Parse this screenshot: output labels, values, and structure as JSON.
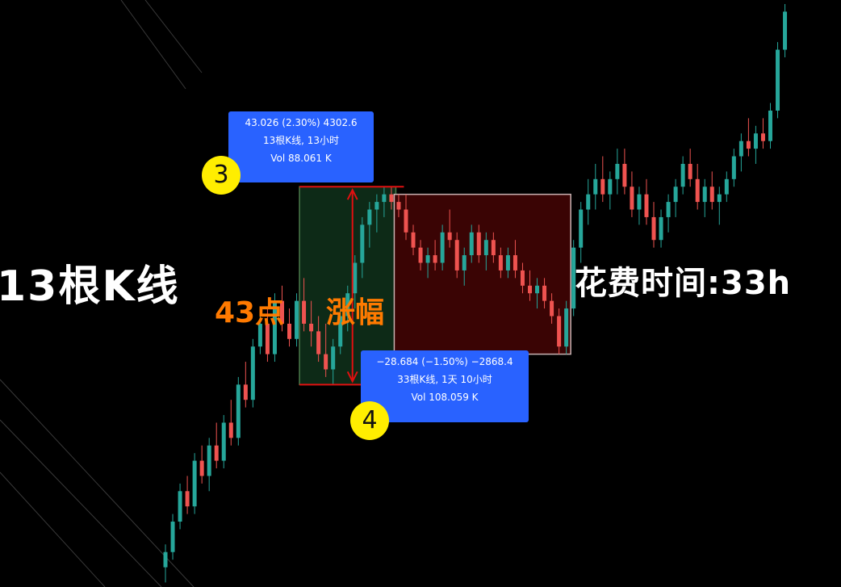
{
  "left_caption": "13根K线",
  "right_caption": "花费时间:33h",
  "points_label": "43点",
  "rise_label": "涨幅",
  "measure_up": {
    "badge": "3",
    "line1": "43.026 (2.30%) 4302.6",
    "line2": "13根K线, 13小时",
    "line3": "Vol 88.061 K"
  },
  "measure_down": {
    "badge": "4",
    "line1": "−28.684 (−1.50%) −2868.4",
    "line2": "33根K线, 1天 10小时",
    "line3": "Vol 108.059 K"
  },
  "colors": {
    "up": "#26a69a",
    "down": "#ef5350",
    "measure_up_fill": "#0d2a17",
    "measure_down_fill": "#3a0404",
    "arrow": "#e01010",
    "box": "#2962ff",
    "badge": "#ffee00",
    "accent_text": "#ff7a00"
  },
  "chart_data": {
    "type": "candlestick",
    "title": "",
    "xlabel": "",
    "ylabel": "",
    "ylim": [
      1850,
      1925
    ],
    "grid": false,
    "axes_visible": false,
    "series": [
      {
        "values": [
          [
            1851,
            1854,
            1849,
            1853
          ],
          [
            1853,
            1858,
            1852,
            1857
          ],
          [
            1857,
            1862,
            1856,
            1861
          ],
          [
            1861,
            1863,
            1858,
            1859
          ],
          [
            1859,
            1866,
            1858,
            1865
          ],
          [
            1865,
            1867,
            1862,
            1863
          ],
          [
            1863,
            1868,
            1861,
            1867
          ],
          [
            1867,
            1870,
            1864,
            1865
          ],
          [
            1865,
            1871,
            1864,
            1870
          ],
          [
            1870,
            1873,
            1867,
            1868
          ],
          [
            1868,
            1876,
            1867,
            1875
          ],
          [
            1875,
            1878,
            1872,
            1873
          ],
          [
            1873,
            1881,
            1872,
            1880
          ],
          [
            1880,
            1884,
            1879,
            1883
          ],
          [
            1883,
            1885,
            1878,
            1879
          ],
          [
            1879,
            1887,
            1878,
            1886
          ],
          [
            1886,
            1888,
            1882,
            1883
          ],
          [
            1883,
            1885,
            1880,
            1881
          ],
          [
            1881,
            1887,
            1880,
            1886
          ],
          [
            1886,
            1889,
            1882,
            1883
          ],
          [
            1883,
            1886,
            1880,
            1882
          ],
          [
            1882,
            1884,
            1878,
            1879
          ],
          [
            1879,
            1883,
            1876,
            1877
          ],
          [
            1877,
            1881,
            1875,
            1880
          ],
          [
            1880,
            1885,
            1879,
            1884
          ],
          [
            1884,
            1888,
            1882,
            1887
          ],
          [
            1887,
            1892,
            1885,
            1891
          ],
          [
            1891,
            1897,
            1889,
            1896
          ],
          [
            1896,
            1899,
            1893,
            1898
          ],
          [
            1898,
            1900,
            1895,
            1899
          ],
          [
            1899,
            1901,
            1897,
            1900
          ],
          [
            1900,
            1901,
            1898,
            1899
          ],
          [
            1899,
            1900,
            1897,
            1898
          ],
          [
            1898,
            1900,
            1894,
            1895
          ],
          [
            1895,
            1896,
            1892,
            1893
          ],
          [
            1893,
            1894,
            1890,
            1891
          ],
          [
            1891,
            1893,
            1889,
            1892
          ],
          [
            1892,
            1894,
            1890,
            1891
          ],
          [
            1891,
            1896,
            1890,
            1895
          ],
          [
            1895,
            1898,
            1893,
            1894
          ],
          [
            1894,
            1895,
            1889,
            1890
          ],
          [
            1890,
            1893,
            1888,
            1892
          ],
          [
            1892,
            1896,
            1891,
            1895
          ],
          [
            1895,
            1896,
            1891,
            1892
          ],
          [
            1892,
            1895,
            1890,
            1894
          ],
          [
            1894,
            1895,
            1891,
            1892
          ],
          [
            1892,
            1893,
            1889,
            1890
          ],
          [
            1890,
            1893,
            1889,
            1892
          ],
          [
            1892,
            1894,
            1889,
            1890
          ],
          [
            1890,
            1891,
            1887,
            1888
          ],
          [
            1888,
            1890,
            1886,
            1887
          ],
          [
            1887,
            1889,
            1885,
            1888
          ],
          [
            1888,
            1889,
            1885,
            1886
          ],
          [
            1886,
            1887,
            1883,
            1884
          ],
          [
            1884,
            1885,
            1879,
            1880
          ],
          [
            1880,
            1886,
            1879,
            1885
          ],
          [
            1885,
            1894,
            1884,
            1893
          ],
          [
            1893,
            1899,
            1891,
            1898
          ],
          [
            1898,
            1902,
            1896,
            1900
          ],
          [
            1900,
            1904,
            1898,
            1902
          ],
          [
            1902,
            1905,
            1899,
            1900
          ],
          [
            1900,
            1903,
            1898,
            1902
          ],
          [
            1902,
            1906,
            1900,
            1904
          ],
          [
            1904,
            1906,
            1900,
            1901
          ],
          [
            1901,
            1903,
            1897,
            1898
          ],
          [
            1898,
            1901,
            1896,
            1900
          ],
          [
            1900,
            1902,
            1896,
            1897
          ],
          [
            1897,
            1899,
            1893,
            1894
          ],
          [
            1894,
            1898,
            1893,
            1897
          ],
          [
            1897,
            1900,
            1895,
            1899
          ],
          [
            1899,
            1902,
            1897,
            1901
          ],
          [
            1901,
            1905,
            1900,
            1904
          ],
          [
            1904,
            1906,
            1901,
            1902
          ],
          [
            1902,
            1904,
            1898,
            1899
          ],
          [
            1899,
            1902,
            1897,
            1901
          ],
          [
            1901,
            1903,
            1898,
            1899
          ],
          [
            1899,
            1901,
            1896,
            1900
          ],
          [
            1900,
            1903,
            1899,
            1902
          ],
          [
            1902,
            1906,
            1901,
            1905
          ],
          [
            1905,
            1908,
            1903,
            1907
          ],
          [
            1907,
            1910,
            1905,
            1906
          ],
          [
            1906,
            1909,
            1904,
            1908
          ],
          [
            1908,
            1910,
            1906,
            1907
          ],
          [
            1907,
            1912,
            1906,
            1911
          ],
          [
            1911,
            1920,
            1910,
            1919
          ],
          [
            1919,
            1925,
            1918,
            1924
          ]
        ]
      }
    ],
    "annotations": [
      {
        "label": "3",
        "start_index": 19,
        "end_index": 31,
        "change": "43.026 (2.30%) 4302.6",
        "bars": "13根K线, 13小时",
        "volume": "Vol 88.061 K"
      },
      {
        "label": "4",
        "start_index": 32,
        "end_index": 55,
        "change": "−28.684 (−1.50%) −2868.4",
        "bars": "33根K线, 1天 10小时",
        "volume": "Vol 108.059 K"
      }
    ]
  }
}
